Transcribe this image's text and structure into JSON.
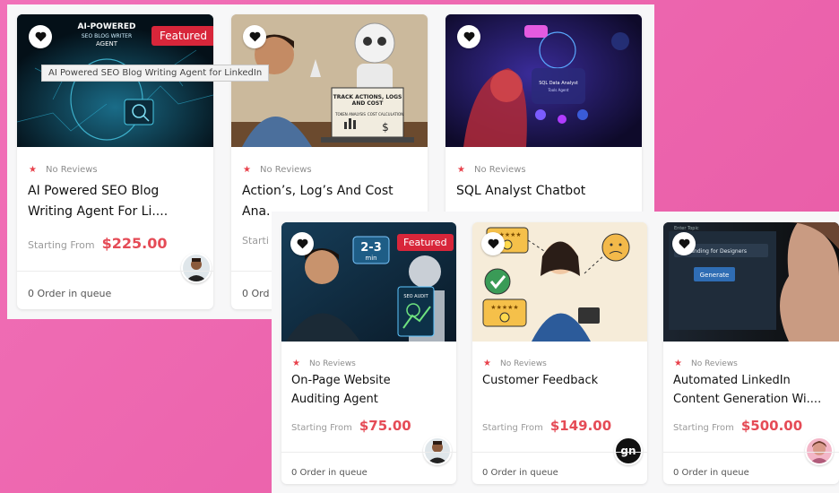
{
  "colors": {
    "accent_red": "#e54b56",
    "badge_red": "#d8263a",
    "background_pink": "#ec64ad"
  },
  "tooltip": "AI Powered SEO Blog Writing Agent for LinkedIn",
  "cards": [
    {
      "id": "seo-blog",
      "featured": true,
      "featured_label": "Featured",
      "reviews": "No Reviews",
      "title_line1": "AI Powered SEO Blog",
      "title_line2": "Writing Agent For Li....",
      "starting_from": "Starting From",
      "price": "$225.00",
      "orders": "0 Order in queue",
      "thumb_text_1": "AI-POWERED",
      "thumb_text_2": "SEO BLOG WRITER",
      "thumb_text_3": "AGENT",
      "avatar": "person-avatar"
    },
    {
      "id": "action-log",
      "featured": false,
      "reviews": "No Reviews",
      "title_line1": "Action’s, Log’s And Cost",
      "title_line2": "Ana...",
      "starting_from": "Starti",
      "price": "",
      "orders": "0 Ord",
      "thumb_text_1": "TRACK ACTIONS, LOGS",
      "thumb_text_2": "AND COST",
      "thumb_text_3": "TOKEN ANALYSIS",
      "thumb_text_4": "COST CALCULATION"
    },
    {
      "id": "sql-analyst",
      "featured": false,
      "reviews": "No Reviews",
      "title_line1": "SQL Analyst Chatbot",
      "title_line2": "",
      "thumb_text_1": "SQL Data Analyst",
      "thumb_text_2": "Tools Agent"
    },
    {
      "id": "onpage-audit",
      "featured": true,
      "featured_label": "Featured",
      "reviews": "No Reviews",
      "title_line1": "On-Page Website",
      "title_line2": "Auditing Agent",
      "starting_from": "Starting From",
      "price": "$75.00",
      "orders": "0 Order in queue",
      "thumb_text_1": "2-3",
      "thumb_text_2": "min",
      "thumb_text_3": "SEO AUDIT",
      "avatar": "person-avatar"
    },
    {
      "id": "customer-feedback",
      "featured": false,
      "reviews": "No Reviews",
      "title_line1": "Customer Feedback",
      "title_line2": "",
      "starting_from": "Starting From",
      "price": "$149.00",
      "orders": "0 Order in queue",
      "avatar_text": "gn"
    },
    {
      "id": "linkedin-content",
      "featured": false,
      "reviews": "No Reviews",
      "title_line1": "Automated LinkedIn",
      "title_line2": "Content Generation Wi....",
      "starting_from": "Starting From",
      "price": "$500.00",
      "orders": "0 Order in queue",
      "thumb_text_1": "Enter Topic",
      "thumb_text_2": "AI Branding for Designers",
      "thumb_text_3": "Generate",
      "avatar": "person-avatar"
    }
  ]
}
